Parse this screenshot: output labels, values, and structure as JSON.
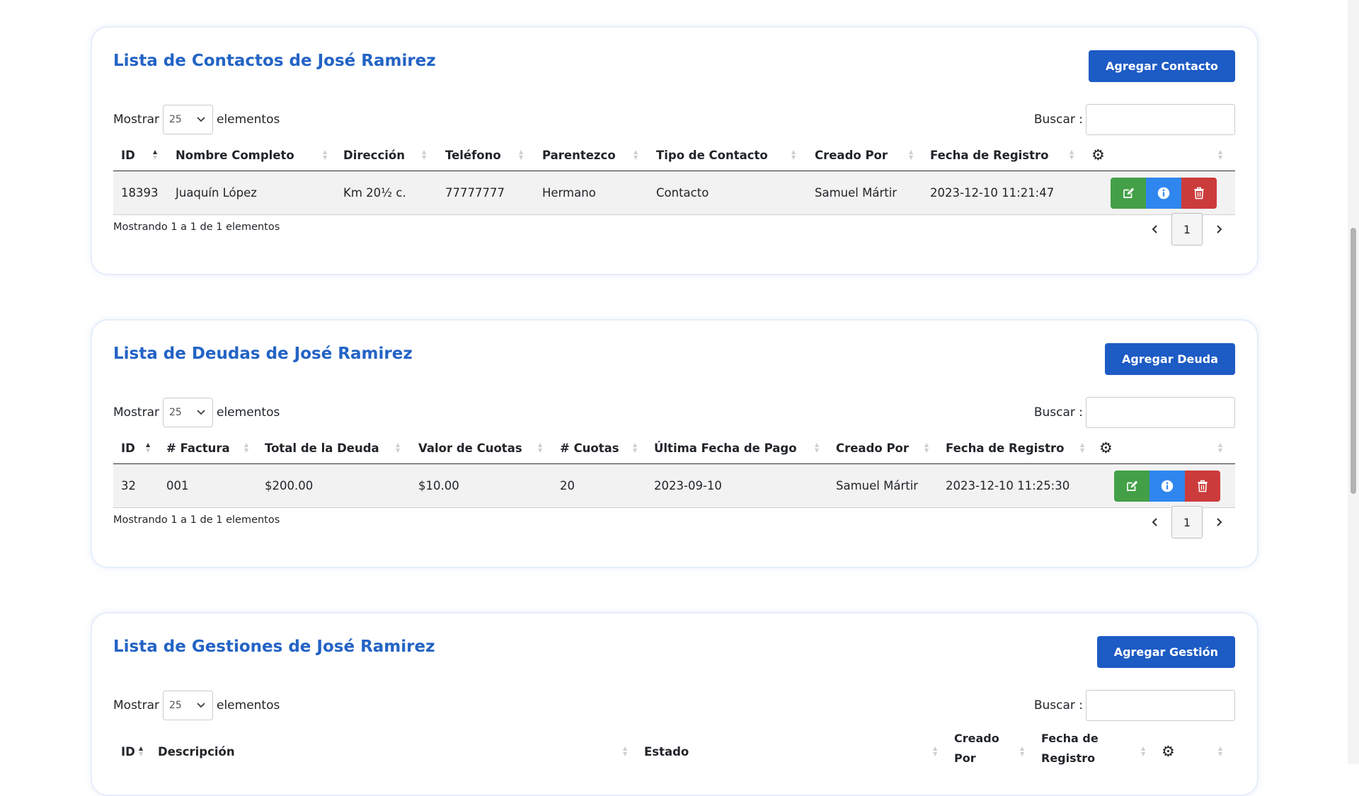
{
  "common": {
    "show_label": "Mostrar",
    "show_value": "25",
    "elements_label": "elementos",
    "search_label": "Buscar :",
    "search_value": "",
    "settings_icon": "gear-icon"
  },
  "contacts": {
    "title": "Lista de Contactos de José Ramirez",
    "add_label": "Agregar Contacto",
    "columns": [
      "ID",
      "Nombre Completo",
      "Dirección",
      "Teléfono",
      "Parentezco",
      "Tipo de Contacto",
      "Creado Por",
      "Fecha de Registro"
    ],
    "rows": [
      [
        "18393",
        "Juaquín López",
        "Km 20½ c.",
        "77777777",
        "Hermano",
        "Contacto",
        "Samuel Mártir",
        "2023-12-10 11:21:47"
      ]
    ],
    "info": "Mostrando 1 a 1 de 1 elementos",
    "page": "1"
  },
  "debts": {
    "title": "Lista de Deudas de José Ramirez",
    "add_label": "Agregar Deuda",
    "columns": [
      "ID",
      "# Factura",
      "Total de la Deuda",
      "Valor de Cuotas",
      "# Cuotas",
      "Última Fecha de Pago",
      "Creado Por",
      "Fecha de Registro"
    ],
    "rows": [
      [
        "32",
        "001",
        "$200.00",
        "$10.00",
        "20",
        "2023-09-10",
        "Samuel Mártir",
        "2023-12-10 11:25:30"
      ]
    ],
    "info": "Mostrando 1 a 1 de 1 elementos",
    "page": "1"
  },
  "gestiones": {
    "title": "Lista de Gestiones de José Ramirez",
    "add_label": "Agregar Gestión",
    "columns": [
      "ID",
      "Descripción",
      "Estado",
      "Creado Por",
      "Fecha de Registro"
    ]
  }
}
